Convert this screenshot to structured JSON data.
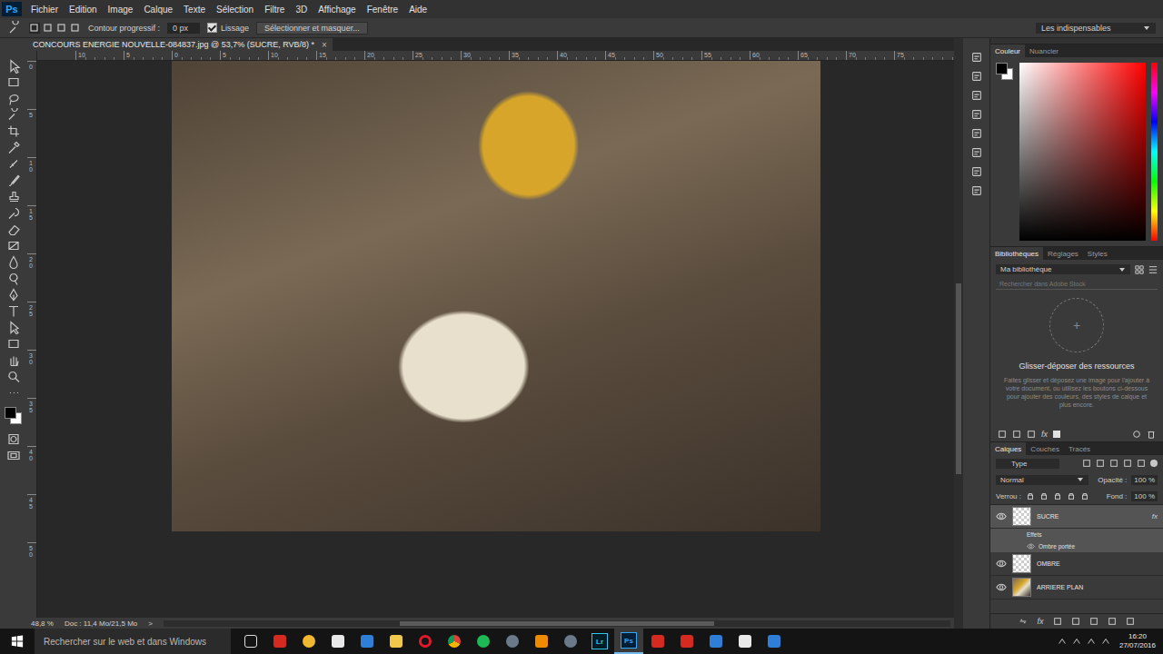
{
  "app": {
    "logo": "Ps"
  },
  "menu": [
    "Fichier",
    "Edition",
    "Image",
    "Calque",
    "Texte",
    "Sélection",
    "Filtre",
    "3D",
    "Affichage",
    "Fenêtre",
    "Aide"
  ],
  "options_bar": {
    "feather_label": "Contour progressif :",
    "feather_value": "0 px",
    "antialias": {
      "label": "Lissage",
      "checked": true
    },
    "select_mask": "Sélectionner et masquer...",
    "workspace": "Les indispensables"
  },
  "document_tab": {
    "title": "CONCOURS ENERGIE NOUVELLE-084837.jpg @ 53,7% (SUCRE, RVB/8) *",
    "close": "×"
  },
  "ruler": {
    "top": [
      "10",
      "5",
      "0",
      "5",
      "10",
      "15",
      "20",
      "25",
      "30",
      "35",
      "40",
      "45",
      "50",
      "55",
      "60",
      "65",
      "70",
      "75"
    ],
    "left": [
      "0",
      "5",
      "10",
      "15",
      "20",
      "25",
      "30",
      "35",
      "40",
      "45",
      "50"
    ]
  },
  "status_bar": {
    "zoom": "48,8 %",
    "doc": "Doc : 11,4 Mo/21,5 Mo",
    "arrow": ">"
  },
  "color_panel": {
    "tabs": [
      {
        "label": "Couleur",
        "selected": true
      },
      {
        "label": "Nuancier",
        "selected": false
      }
    ]
  },
  "libraries_panel": {
    "tabs": [
      {
        "label": "Bibliothèques",
        "selected": true
      },
      {
        "label": "Réglages",
        "selected": false
      },
      {
        "label": "Styles",
        "selected": false
      }
    ],
    "library": "Ma bibliothèque",
    "search_placeholder": "Rechercher dans Adobe Stock",
    "plus": "+",
    "title": "Glisser-déposer des ressources",
    "description": "Faites glisser et déposez une image pour l'ajouter à votre document, ou utilisez les boutons ci-dessous pour ajouter des couleurs, des styles de calque et plus encore.",
    "footer_fx": "fx"
  },
  "layers_panel": {
    "tabs": [
      {
        "label": "Calques",
        "selected": true
      },
      {
        "label": "Couches",
        "selected": false
      },
      {
        "label": "Tracés",
        "selected": false
      }
    ],
    "filter": "Type",
    "blend_mode": "Normal",
    "opacity_label": "Opacité :",
    "opacity": "100 %",
    "lock_label": "Verrou :",
    "fill_label": "Fond :",
    "fill": "100 %",
    "footer_fx": "fx",
    "layers": [
      {
        "name": "SUCRE",
        "selected": true,
        "visible": true,
        "kind": "transparent",
        "fx": "fx",
        "effects_label": "Effets",
        "effects": [
          {
            "name": "Ombre portée",
            "visible": true
          }
        ]
      },
      {
        "name": "OMBRE",
        "selected": false,
        "visible": true,
        "kind": "transparent",
        "fx": "",
        "effects_label": "",
        "effects": []
      },
      {
        "name": "ARRIERE PLAN",
        "selected": false,
        "visible": true,
        "kind": "image",
        "fx": "",
        "effects_label": "",
        "effects": []
      }
    ]
  },
  "taskbar": {
    "search_placeholder": "Rechercher sur le web et dans Windows",
    "time": "16:20",
    "date": "27/07/2016",
    "lightroom": {
      "label": "Lr",
      "active": false
    },
    "photoshop": {
      "label": "Ps",
      "active": true
    }
  }
}
